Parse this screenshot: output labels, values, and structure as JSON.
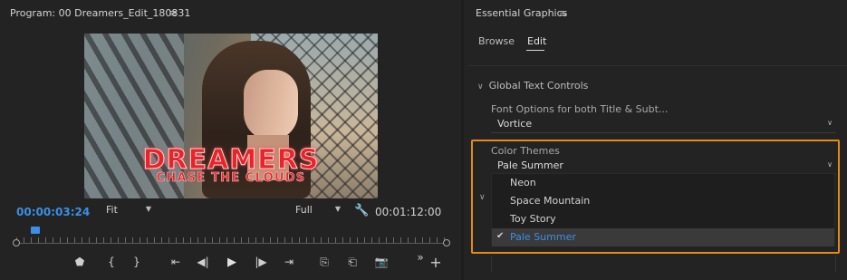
{
  "program_panel": {
    "title": "Program: 00 Dreamers_Edit_180831",
    "menu_icon": "≡",
    "video_title": "DREAMERS",
    "video_subtitle": "CHASE THE CLOUDS",
    "current_timecode": "00:00:03:24",
    "duration_timecode": "00:01:12:00",
    "zoom_select": "Fit",
    "resolution_select": "Full",
    "accent_color": "#3b8fe4",
    "transport": {
      "marker": "⬟",
      "mark_in": "{",
      "mark_out": "}",
      "go_to_in": "⇤",
      "step_back": "◀|",
      "play": "▶",
      "step_forward": "|▶",
      "go_to_out": "⇥",
      "lift": "⎘",
      "extract": "⎗",
      "export_frame": "📷",
      "more": "»",
      "add": "+"
    }
  },
  "essential_graphics": {
    "title": "Essential Graphics",
    "menu_icon": "≡",
    "tabs": [
      {
        "label": "Browse"
      },
      {
        "label": "Edit"
      }
    ],
    "active_tab": "Edit",
    "section_title": "Global Text Controls",
    "font_label": "Font Options for both Title & Subt...",
    "font_value": "Vortice",
    "color_themes_label": "Color Themes",
    "color_themes_value": "Pale Summer",
    "color_themes_options": [
      "Neon",
      "Space Mountain",
      "Toy Story",
      "Pale Summer"
    ],
    "selected_option": "Pale Summer",
    "highlight_color": "#e08b1c"
  }
}
